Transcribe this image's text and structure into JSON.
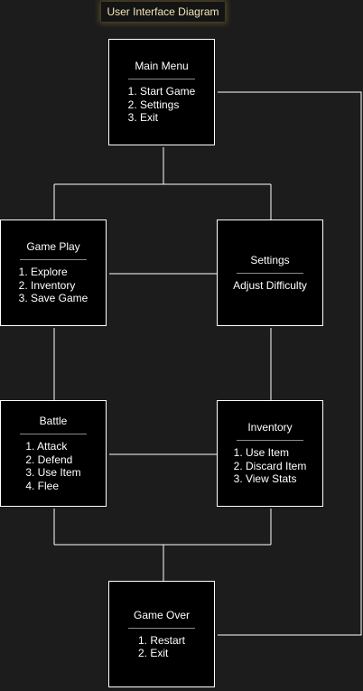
{
  "title": "User Interface Diagram",
  "line_color": "#ffffff",
  "nodes": {
    "main_menu": {
      "title": "Main Menu",
      "items": [
        "1. Start Game",
        "2. Settings",
        "3. Exit"
      ]
    },
    "game_play": {
      "title": "Game Play",
      "items": [
        "1. Explore",
        "2. Inventory",
        "3. Save Game"
      ]
    },
    "settings": {
      "title": "Settings",
      "items": [
        "Adjust Difficulty"
      ]
    },
    "battle": {
      "title": "Battle",
      "items": [
        "1. Attack",
        "2. Defend",
        "3. Use Item",
        "4. Flee"
      ]
    },
    "inventory": {
      "title": "Inventory",
      "items": [
        "1. Use Item",
        "2. Discard Item",
        "3. View Stats"
      ]
    },
    "game_over": {
      "title": "Game Over",
      "items": [
        "1. Restart",
        "2. Exit"
      ]
    }
  }
}
